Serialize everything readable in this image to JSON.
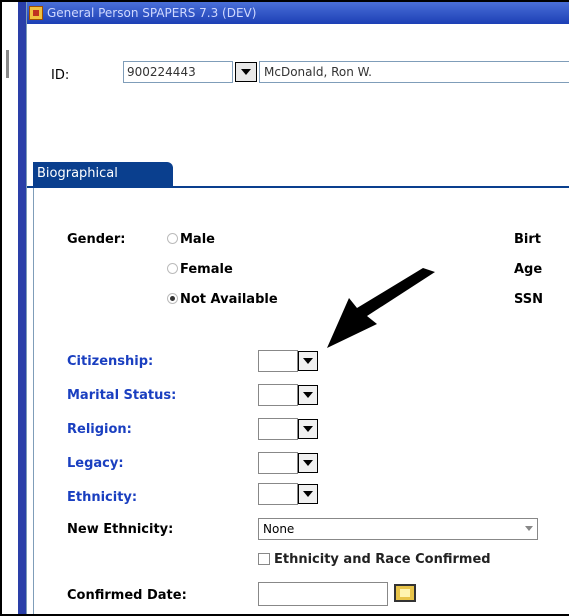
{
  "window": {
    "title": "General Person SPAPERS 7.3 (DEV)"
  },
  "key_block": {
    "id_label": "ID:",
    "id_value": "900224443",
    "name_value": "McDonald, Ron W."
  },
  "tab": {
    "label": "Biographical"
  },
  "biographical": {
    "gender_label": "Gender:",
    "gender_options": [
      "Male",
      "Female",
      "Not Available"
    ],
    "gender_selected": "Not Available",
    "right_labels": [
      "Birt",
      "Age",
      "SSN"
    ],
    "citizenship_label": "Citizenship:",
    "marital_label": "Marital Status:",
    "religion_label": "Religion:",
    "legacy_label": "Legacy:",
    "ethnicity_label": "Ethnicity:",
    "new_ethnicity_label": "New Ethnicity:",
    "new_ethnicity_value": "None",
    "confirmed_checkbox_label": "Ethnicity and Race Confirmed",
    "confirmed_date_label": "Confirmed Date:"
  },
  "colors": {
    "accent_blue": "#1a3fc0",
    "tab_blue": "#0a3f8e",
    "edge_blue": "#2a3fa8"
  },
  "icons": [
    "dropdown-arrow-icon",
    "calendar-icon",
    "pointer-arrow-icon"
  ]
}
